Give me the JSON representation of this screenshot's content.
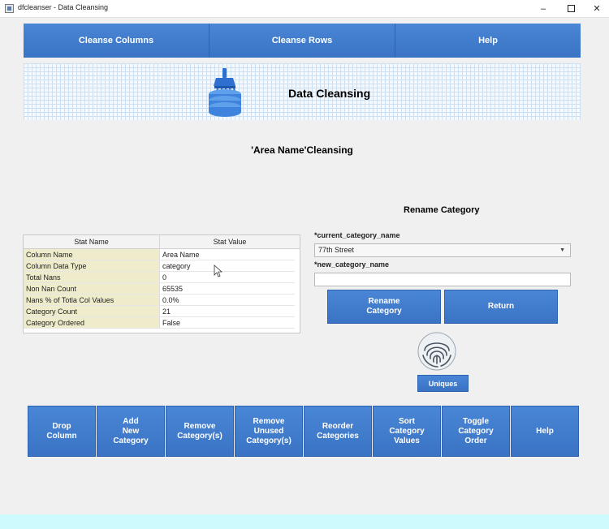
{
  "window": {
    "title": "dfcleanser - Data Cleansing",
    "minimize_glyph": "–",
    "close_glyph": "✕"
  },
  "topnav": {
    "cleanse_columns": "Cleanse Columns",
    "cleanse_rows": "Cleanse Rows",
    "help": "Help"
  },
  "banner": {
    "title": "Data Cleansing",
    "logo_icon": "database-brush-icon"
  },
  "section": {
    "title": "'Area Name'Cleansing"
  },
  "stats_table": {
    "headers": [
      "Stat Name",
      "Stat Value"
    ],
    "rows": [
      {
        "name": "Column Name",
        "value": "Area Name"
      },
      {
        "name": "Column Data Type",
        "value": "category"
      },
      {
        "name": "Total Nans",
        "value": "0"
      },
      {
        "name": "Non Nan Count",
        "value": "65535"
      },
      {
        "name": "Nans % of Totla Col Values",
        "value": "0.0%"
      },
      {
        "name": "Category Count",
        "value": "21"
      },
      {
        "name": "Category Ordered",
        "value": "False"
      }
    ]
  },
  "rename": {
    "title": "Rename Category",
    "current_label": "*current_category_name",
    "current_value": "77th Street",
    "new_label": "*new_category_name",
    "new_value": "",
    "rename_button": "Rename\nCategory",
    "return_button": "Return",
    "uniques_button": "Uniques"
  },
  "bottom_buttons": [
    "Drop\nColumn",
    "Add\nNew\nCategory",
    "Remove\nCategory(s)",
    "Remove\nUnused\nCategory(s)",
    "Reorder\nCategories",
    "Sort\nCategory\nValues",
    "Toggle\nCategory\nOrder",
    "Help"
  ],
  "colors": {
    "button_blue": "#3a73c4",
    "stat_name_bg": "#efeccb",
    "footer": "#ccfafd"
  }
}
